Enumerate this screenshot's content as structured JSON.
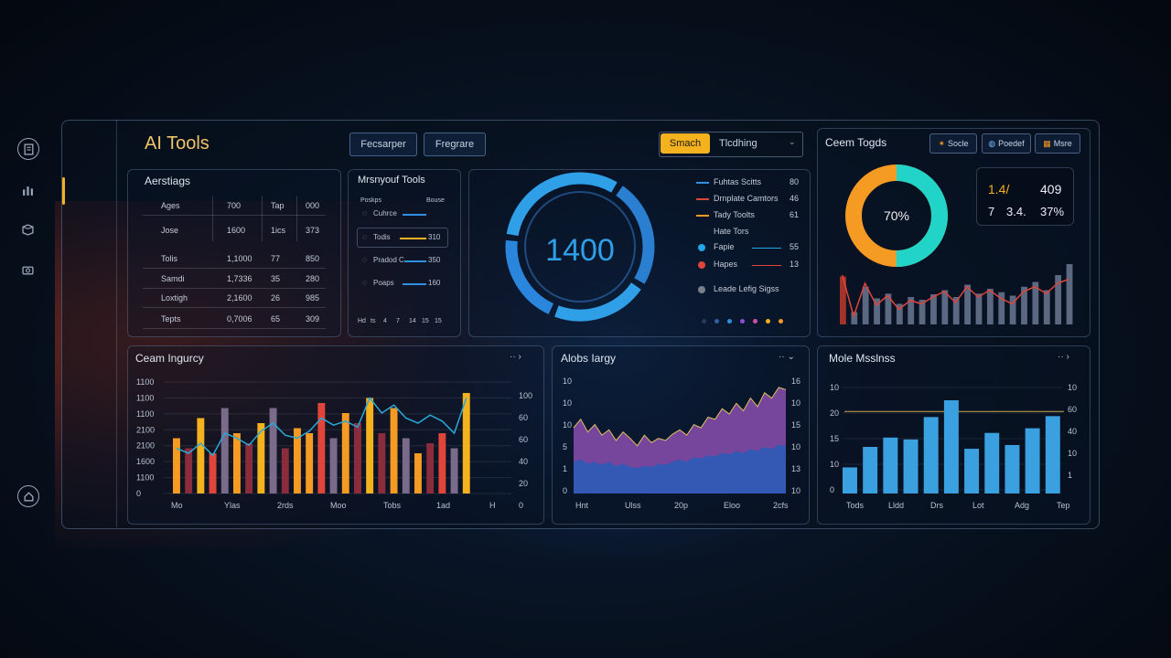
{
  "app": {
    "title": "AI Tools"
  },
  "toolbar": {
    "buttons": [
      "Fecsarper",
      "Fregrare"
    ],
    "search_label": "Smach",
    "search_value": "Tlcdhing"
  },
  "sidebar": {
    "icons": [
      "document-icon",
      "chart-icon",
      "box-icon",
      "camera-icon"
    ],
    "bottom_icon": "home-icon"
  },
  "colors": {
    "accent": "#f5b21f",
    "blue": "#2f8fe0",
    "cyan": "#22d3c8",
    "orange": "#f59a23",
    "red": "#e0453a"
  },
  "aerstats": {
    "title": "Aerstiags",
    "rows": [
      [
        "Ages",
        "700",
        "Tap",
        "000"
      ],
      [
        "Jose",
        "1600",
        "1ics",
        "373"
      ],
      [
        "Tolis",
        "1,1000",
        "77",
        "850"
      ],
      [
        "Samdi",
        "1,7336",
        "35",
        "280"
      ],
      [
        "Loxtigh",
        "2,1600",
        "26",
        "985"
      ],
      [
        "Tepts",
        "0,7006",
        "65",
        "309"
      ]
    ]
  },
  "tools": {
    "title": "Mrsnyouf Tools",
    "col_left": "Poskps",
    "col_right": "Bouse",
    "items": [
      {
        "label": "Cuhrce",
        "value": "",
        "color": "#2f8fe0"
      },
      {
        "label": "Todis",
        "value": "310",
        "color": "#f5b21f"
      },
      {
        "label": "Pradod C",
        "value": "350",
        "color": "#2f8fe0"
      },
      {
        "label": "Poaps",
        "value": "160",
        "color": "#2f8fe0"
      }
    ],
    "axis": [
      "Hd",
      "ts",
      "4",
      "7",
      "14",
      "15",
      "15"
    ]
  },
  "gauge": {
    "value_text": "1400",
    "legend": [
      {
        "label": "Fuhtas Scitts",
        "value": "80",
        "color": "#2f8fe0",
        "marker": "line"
      },
      {
        "label": "Drnplate Camtors",
        "value": "46",
        "color": "#e0453a",
        "marker": "line"
      },
      {
        "label": "Tady Toolts",
        "value": "61",
        "color": "#f59a23",
        "marker": "line"
      },
      {
        "label": "Hate Tors",
        "value": "",
        "color": "",
        "marker": "none"
      },
      {
        "label": "Fapie",
        "value": "55",
        "color": "#22a6e8",
        "marker": "dot"
      },
      {
        "label": "Hapes",
        "value": "13",
        "color": "#e0453a",
        "marker": "dot"
      },
      {
        "label": "Leade Lefig Sigss",
        "value": "",
        "color": "#7a7f8c",
        "marker": "dot"
      }
    ],
    "dots": [
      "#263a5a",
      "#2f5fa0",
      "#2f8fe0",
      "#8a4fd8",
      "#d04fa0",
      "#f5b21f",
      "#f59a23"
    ]
  },
  "ceam_tools": {
    "title": "Ceem Togds",
    "pills": [
      "Socle",
      "Poedef",
      "Msre"
    ],
    "donut_text": "70%",
    "donut_percent": 70,
    "stats": [
      "1.4/",
      "409",
      "7",
      "3.4.",
      "37%"
    ],
    "bars": [
      70,
      18,
      55,
      38,
      45,
      30,
      40,
      36,
      44,
      50,
      40,
      58,
      45,
      52,
      47,
      42,
      55,
      62,
      50,
      72,
      88
    ],
    "line": [
      72,
      12,
      60,
      28,
      42,
      22,
      35,
      30,
      40,
      48,
      32,
      55,
      40,
      50,
      38,
      30,
      48,
      55,
      45,
      60,
      66
    ]
  },
  "charts": [
    {
      "title": "Ceam Ingurcy",
      "controls": "·· ›",
      "type": "bar",
      "yticks_left": [
        "1100",
        "1100",
        "1100",
        "2100",
        "2100",
        "1600",
        "1100",
        "0"
      ],
      "yticks_right": [
        "100",
        "60",
        "60",
        "40",
        "20",
        "0"
      ],
      "xlabels": [
        "Mo",
        "Ylas",
        "2rds",
        "Moo",
        "Tobs",
        "1ad",
        "H"
      ],
      "bars": [
        {
          "v": 55,
          "c": "#f59a23"
        },
        {
          "v": 45,
          "c": "#8a2c3c"
        },
        {
          "v": 75,
          "c": "#f5b21f"
        },
        {
          "v": 40,
          "c": "#e0453a"
        },
        {
          "v": 85,
          "c": "#7a6b8a"
        },
        {
          "v": 60,
          "c": "#f59a23"
        },
        {
          "v": 50,
          "c": "#8a2c3c"
        },
        {
          "v": 70,
          "c": "#f5b21f"
        },
        {
          "v": 85,
          "c": "#7a6b8a"
        },
        {
          "v": 45,
          "c": "#8a2c3c"
        },
        {
          "v": 65,
          "c": "#f59a23"
        },
        {
          "v": 60,
          "c": "#f59a23"
        },
        {
          "v": 90,
          "c": "#e0453a"
        },
        {
          "v": 55,
          "c": "#7a6b8a"
        },
        {
          "v": 80,
          "c": "#f59a23"
        },
        {
          "v": 70,
          "c": "#8a2c3c"
        },
        {
          "v": 95,
          "c": "#f5b21f"
        },
        {
          "v": 60,
          "c": "#8a2c3c"
        },
        {
          "v": 85,
          "c": "#f59a23"
        },
        {
          "v": 55,
          "c": "#7a6b8a"
        },
        {
          "v": 40,
          "c": "#f59a23"
        },
        {
          "v": 50,
          "c": "#8a2c3c"
        },
        {
          "v": 60,
          "c": "#e0453a"
        },
        {
          "v": 45,
          "c": "#7a6b8a"
        },
        {
          "v": 100,
          "c": "#f5b21f"
        }
      ],
      "line": [
        45,
        40,
        50,
        38,
        60,
        55,
        48,
        62,
        70,
        58,
        55,
        62,
        75,
        68,
        72,
        66,
        95,
        80,
        88,
        75,
        70,
        78,
        72,
        60,
        95
      ]
    },
    {
      "title": "Alobs Iargy",
      "controls": "·· ⌄",
      "type": "area",
      "yticks_left": [
        "10",
        "10",
        "10",
        "5",
        "1",
        "0"
      ],
      "yticks_right": [
        "16",
        "10",
        "15",
        "10",
        "13",
        "10"
      ],
      "xlabels": [
        "Hnt",
        "Ulss",
        "20p",
        "Eloo",
        "2cfs"
      ],
      "top": [
        62,
        70,
        58,
        65,
        55,
        60,
        50,
        58,
        52,
        45,
        55,
        48,
        52,
        50,
        56,
        60,
        55,
        65,
        62,
        72,
        70,
        80,
        75,
        85,
        78,
        90,
        82,
        95,
        90,
        100,
        98
      ],
      "bottom": [
        30,
        32,
        28,
        30,
        27,
        30,
        26,
        28,
        25,
        24,
        26,
        25,
        28,
        27,
        30,
        32,
        30,
        34,
        33,
        36,
        35,
        38,
        37,
        40,
        38,
        42,
        40,
        44,
        42,
        46,
        45
      ]
    },
    {
      "title": "Mole Msslnss",
      "controls": "·· ›",
      "type": "bar",
      "yticks_left": [
        "10",
        "20",
        "15",
        "10",
        "0"
      ],
      "yticks_right": [
        "10",
        "60",
        "40",
        "10",
        "1"
      ],
      "xlabels": [
        "Tods",
        "Lldd",
        "Drs",
        "Lot",
        "Adg",
        "Tep"
      ],
      "bars": [
        {
          "v": 28,
          "c": "#3aa0e0"
        },
        {
          "v": 50,
          "c": "#3aa0e0"
        },
        {
          "v": 60,
          "c": "#3aa0e0"
        },
        {
          "v": 58,
          "c": "#3aa0e0"
        },
        {
          "v": 82,
          "c": "#3aa0e0"
        },
        {
          "v": 100,
          "c": "#3aa0e0"
        },
        {
          "v": 48,
          "c": "#3aa0e0"
        },
        {
          "v": 65,
          "c": "#3aa0e0"
        },
        {
          "v": 52,
          "c": "#3aa0e0"
        },
        {
          "v": 70,
          "c": "#3aa0e0"
        },
        {
          "v": 83,
          "c": "#3aa0e0"
        }
      ],
      "guide": 88
    }
  ]
}
